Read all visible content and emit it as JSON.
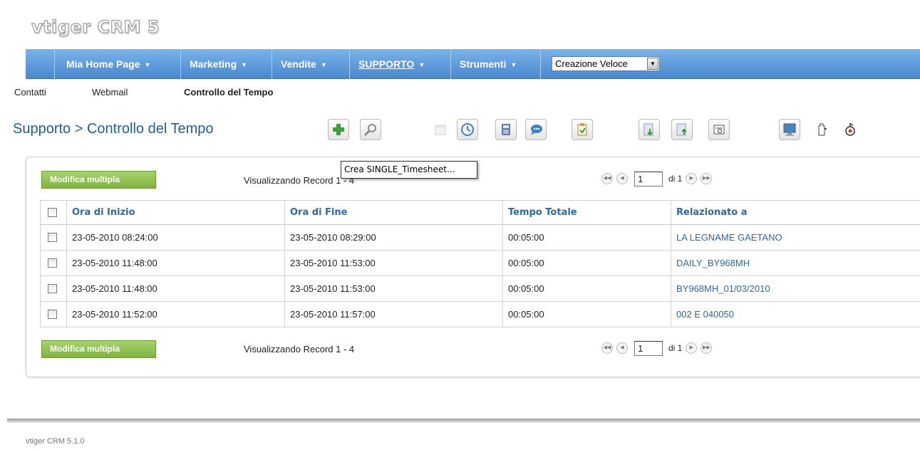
{
  "app": {
    "logo_text": "vtiger CRM 5"
  },
  "nav": {
    "items": [
      {
        "label": "Mia Home Page"
      },
      {
        "label": "Marketing"
      },
      {
        "label": "Vendite"
      },
      {
        "label": "SUPPORTO"
      },
      {
        "label": "Strumenti"
      }
    ],
    "quick_create": "Creazione Veloce"
  },
  "subnav": {
    "items": [
      "Contatti",
      "Webmail",
      "Controllo del Tempo"
    ]
  },
  "page": {
    "module": "Supporto",
    "separator": ">",
    "title": "Controllo del Tempo"
  },
  "toolbar": {
    "icons": [
      "add-icon",
      "search-icon",
      "calendar-icon",
      "clock-icon",
      "calculator-icon",
      "chat-icon",
      "clipboard-icon",
      "import-icon",
      "export-icon",
      "find-duplicates-icon",
      "monitor-icon",
      "settings-icon",
      "tag-icon"
    ],
    "tooltip": "Crea SINGLE_Timesheet..."
  },
  "list": {
    "mass_edit_label": "Modifica multipla",
    "showing_text": "Visualizzando Record 1 - 4",
    "page_value": "1",
    "page_of": "di 1",
    "columns": [
      "Ora di Inizio",
      "Ora di Fine",
      "Tempo Totale",
      "Relazionato a"
    ],
    "rows": [
      [
        "23-05-2010 08:24:00",
        "23-05-2010 08:29:00",
        "00:05:00",
        "LA LEGNAME GAETANO"
      ],
      [
        "23-05-2010 11:48:00",
        "23-05-2010 11:53:00",
        "00:05:00",
        "DAILY_BY968MH"
      ],
      [
        "23-05-2010 11:48:00",
        "23-05-2010 11:53:00",
        "00:05:00",
        "BY968MH_01/03/2010"
      ],
      [
        "23-05-2010 11:52:00",
        "23-05-2010 11:57:00",
        "00:05:00",
        "002 E 040050"
      ]
    ]
  },
  "footer": {
    "version": "vtiger CRM 5.1.0"
  },
  "colors": {
    "nav_top": "#79b3ea",
    "nav_bottom": "#4a88cf",
    "title": "#1e5f95",
    "link": "#2c6aa8",
    "mass_edit": "#8fc24f"
  }
}
